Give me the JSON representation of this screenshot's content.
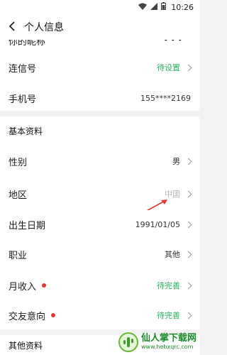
{
  "status": {
    "time": "10:26"
  },
  "header": {
    "title": "个人信息"
  },
  "top_rows": [
    {
      "label": "你的昵称",
      "value": "• • •"
    },
    {
      "label": "连信号",
      "value": "待设置"
    },
    {
      "label": "手机号",
      "value": "155****2169"
    }
  ],
  "section": {
    "title": "基本资料"
  },
  "rows": [
    {
      "label": "性别",
      "value": "男"
    },
    {
      "label": "地区",
      "value": "中国"
    },
    {
      "label": "出生日期",
      "value": "1991/01/05"
    },
    {
      "label": "职业",
      "value": "其他"
    },
    {
      "label": "月收入",
      "value": "待完善"
    },
    {
      "label": "交友意向",
      "value": "待完善"
    }
  ],
  "bottom_section": {
    "title": "其他资料"
  },
  "watermark": {
    "title": "仙人掌下载网",
    "url": "www.hebxqrc.com"
  },
  "colors": {
    "green": "#27b45e",
    "red": "#e53935"
  }
}
